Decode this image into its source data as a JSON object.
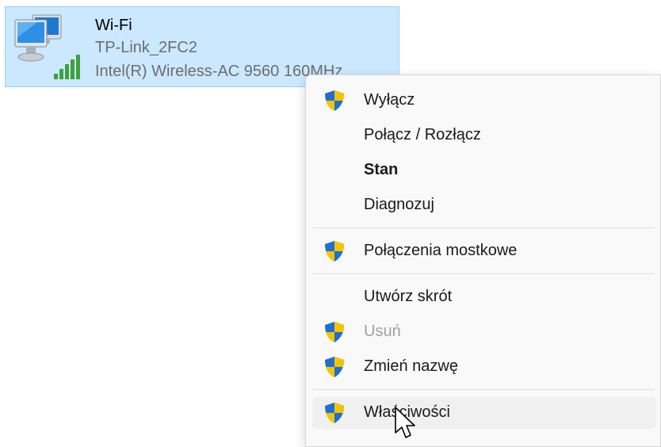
{
  "adapter": {
    "name": "Wi-Fi",
    "ssid": "TP-Link_2FC2",
    "device": "Intel(R) Wireless-AC 9560 160MHz"
  },
  "menu": {
    "items": [
      {
        "label": "Wyłącz",
        "icon": "uac-shield-icon",
        "bold": false,
        "disabled": false
      },
      {
        "label": "Połącz / Rozłącz",
        "icon": null,
        "bold": false,
        "disabled": false
      },
      {
        "label": "Stan",
        "icon": null,
        "bold": true,
        "disabled": false
      },
      {
        "label": "Diagnozuj",
        "icon": null,
        "bold": false,
        "disabled": false
      },
      {
        "label": "Połączenia mostkowe",
        "icon": "uac-shield-icon",
        "bold": false,
        "disabled": false
      },
      {
        "label": "Utwórz skrót",
        "icon": null,
        "bold": false,
        "disabled": false
      },
      {
        "label": "Usuń",
        "icon": "uac-shield-icon",
        "bold": false,
        "disabled": true
      },
      {
        "label": "Zmień nazwę",
        "icon": "uac-shield-icon",
        "bold": false,
        "disabled": false
      },
      {
        "label": "Właściwości",
        "icon": "uac-shield-icon",
        "bold": false,
        "disabled": false,
        "hovered": true
      }
    ]
  },
  "colors": {
    "selection_bg": "#cce8ff",
    "selection_border": "#99d1ff",
    "menu_bg": "#f9f9f9",
    "signal_green": "#3ca23c"
  }
}
